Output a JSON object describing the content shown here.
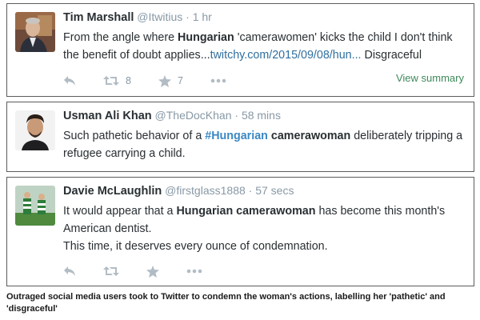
{
  "tweets": [
    {
      "name": "Tim Marshall",
      "handle": "@Itwitius",
      "time": "1 hr",
      "text": {
        "p1": "From the angle where ",
        "b1": "Hungarian",
        "p2": " 'camerawomen' kicks the child I don't think",
        "p3": "the benefit of doubt applies...",
        "link": "twitchy.com/2015/09/08/hun...",
        "p4": " Disgraceful"
      },
      "retweets": "8",
      "favorites": "7",
      "view_summary": "View summary"
    },
    {
      "name": "Usman Ali Khan",
      "handle": "@TheDocKhan",
      "time": "58 mins",
      "text": {
        "p1": "Such pathetic behavior of a ",
        "tag": "#Hungarian",
        "p2": " ",
        "b1": "camerawoman",
        "p3": " deliberately tripping a",
        "p4": "refugee carrying a child."
      }
    },
    {
      "name": "Davie McLaughlin",
      "handle": "@firstglass1888",
      "time": "57 secs",
      "text": {
        "p1": "It would appear that a ",
        "b1": "Hungarian camerawoman",
        "p2": " has become this month's",
        "p3": "American dentist.",
        "p4": "This time, it deserves every ounce of condemnation."
      }
    }
  ],
  "caption": "Outraged social media users took to Twitter to condemn the woman's actions, labelling her 'pathetic' and 'disgraceful'",
  "separator": "·",
  "icons": {
    "reply": "reply-icon",
    "retweet": "retweet-icon",
    "favorite": "star-icon",
    "more": "more-icon"
  },
  "colors": {
    "link": "#2f6f9f",
    "hashtag": "#3b88c3",
    "summary": "#3e8a5a",
    "muted": "#8899a6"
  }
}
